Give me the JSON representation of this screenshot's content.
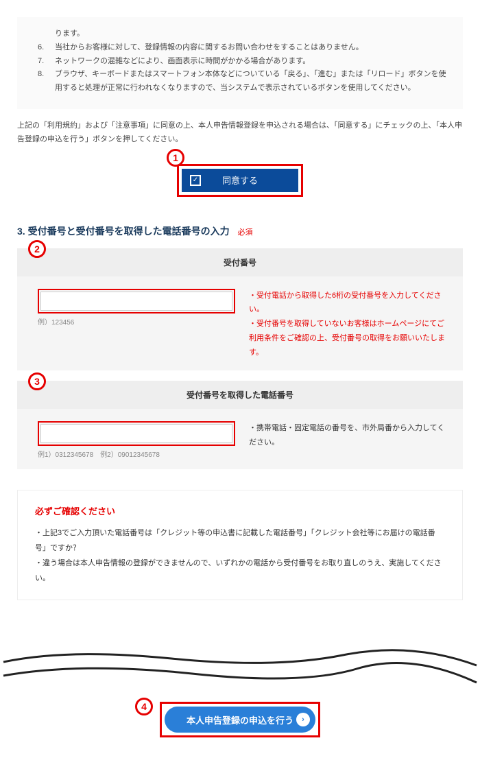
{
  "notices": {
    "item6_num": "6.",
    "item6_text": "当社からお客様に対して、登録情報の内容に関するお問い合わせをすることはありません。",
    "item7_num": "7.",
    "item7_text": "ネットワークの混雑などにより、画面表示に時間がかかる場合があります。",
    "item8_num": "8.",
    "item8_text": "ブラウザ、キーボードまたはスマートフォン本体などについている「戻る」、「進む」または「リロード」ボタンを使用すると処理が正常に行われなくなりますので、当システムで表示されているボタンを使用してください。",
    "item5_tail": "ります。"
  },
  "instruction": "上記の「利用規約」および「注意事項」に同意の上、本人申告情報登録を申込される場合は、「同意する」にチェックの上、「本人申告登録の申込を行う」ボタンを押してください。",
  "agree_label": "同意する",
  "markers": {
    "m1": "1",
    "m2": "2",
    "m3": "3",
    "m4": "4"
  },
  "section3": {
    "title": "3. 受付番号と受付番号を取得した電話番号の入力",
    "required": "必須"
  },
  "reception": {
    "header": "受付番号",
    "placeholder": "",
    "example": "例）123456",
    "hint1": "・受付電話から取得した6桁の受付番号を入力してください。",
    "hint2": "・受付番号を取得していないお客様はホームページにてご利用条件をご確認の上、受付番号の取得をお願いいたします。"
  },
  "phone": {
    "header": "受付番号を取得した電話番号",
    "placeholder": "",
    "example": "例1）0312345678　例2）09012345678",
    "hint1": "・携帯電話・固定電話の番号を、市外局番から入力してください。"
  },
  "confirm": {
    "title": "必ずご確認ください",
    "line1": "・上記3でご入力頂いた電話番号は「クレジット等の申込書に記載した電話番号」「クレジット会社等にお届けの電話番号」ですか？",
    "line2": "・違う場合は本人申告情報の登録ができませんので、いずれかの電話から受付番号をお取り直しのうえ、実施してください。"
  },
  "submit_label": "本人申告登録の申込を行う"
}
